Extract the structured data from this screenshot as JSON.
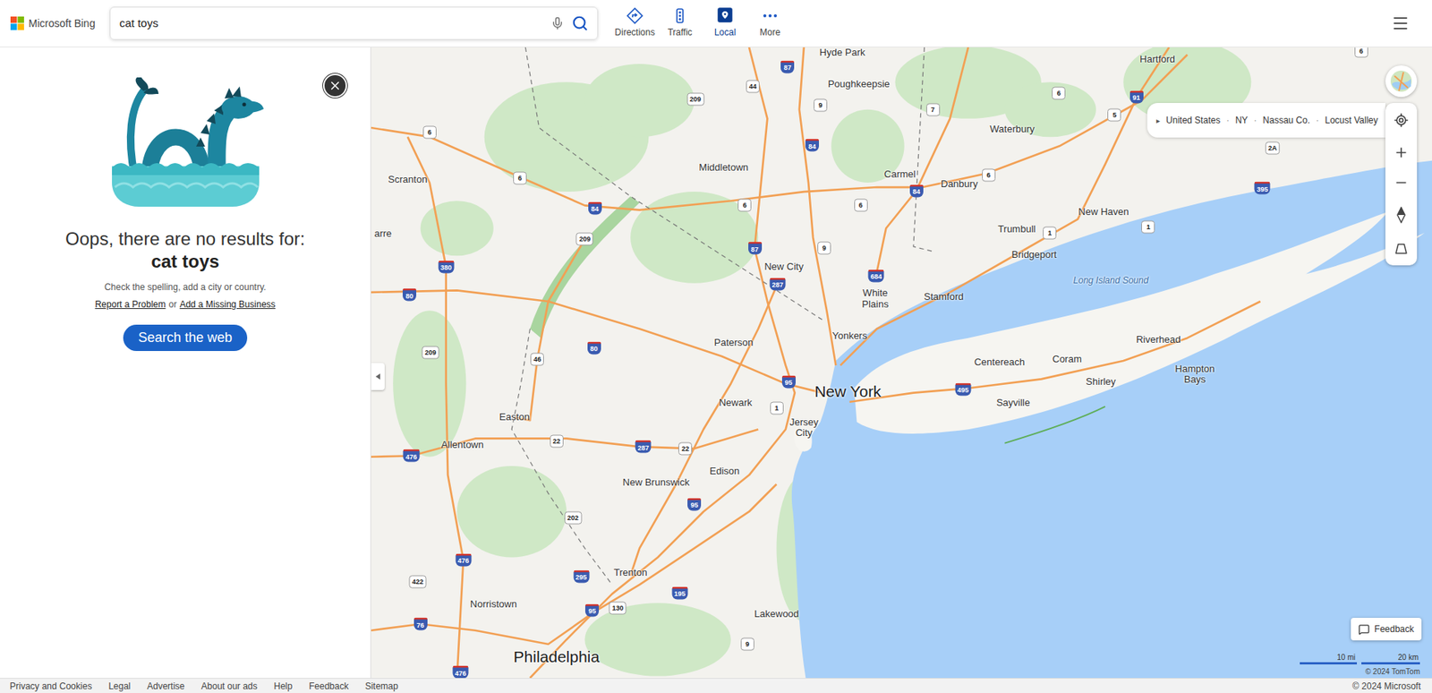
{
  "app": {
    "logo": "Microsoft Bing"
  },
  "search": {
    "value": "cat toys"
  },
  "nav": [
    {
      "label": "Directions",
      "selected": false
    },
    {
      "label": "Traffic",
      "selected": false
    },
    {
      "label": "Local",
      "selected": true
    },
    {
      "label": "More",
      "selected": false
    }
  ],
  "panel": {
    "title": "Oops, there are no results for:",
    "query": "cat toys",
    "hint": "Check the spelling, add a city or country.",
    "links": [
      "Report a Problem",
      "Add a Missing Business"
    ],
    "joiner": "or",
    "button": "Search the web"
  },
  "breadcrumb": {
    "arrow": "▸",
    "separator": "·",
    "items": [
      "United States",
      "NY",
      "Nassau Co.",
      "Locust Valley"
    ]
  },
  "map": {
    "places": [
      {
        "name": "Hyde Park",
        "kind": "city"
      },
      {
        "name": "Poughkeepsie",
        "kind": "city"
      },
      {
        "name": "Hartford",
        "kind": "city"
      },
      {
        "name": "Waterbury",
        "kind": "city"
      },
      {
        "name": "Middletown",
        "kind": "city"
      },
      {
        "name": "Scranton",
        "kind": "city"
      },
      {
        "name": "Carmel",
        "kind": "city"
      },
      {
        "name": "Danbury",
        "kind": "city"
      },
      {
        "name": "New Haven",
        "kind": "city"
      },
      {
        "name": "Trumbull",
        "kind": "city"
      },
      {
        "name": "Bridgeport",
        "kind": "city"
      },
      {
        "name": "New City",
        "kind": "city"
      },
      {
        "name": "Long Island Sound",
        "kind": "water"
      },
      {
        "name": "White Plains",
        "kind": "city"
      },
      {
        "name": "Stamford",
        "kind": "city"
      },
      {
        "name": "Paterson",
        "kind": "city"
      },
      {
        "name": "Yonkers",
        "kind": "city"
      },
      {
        "name": "Riverhead",
        "kind": "city"
      },
      {
        "name": "Centereach",
        "kind": "city"
      },
      {
        "name": "Coram",
        "kind": "city"
      },
      {
        "name": "Hampton Bays",
        "kind": "city"
      },
      {
        "name": "Shirley",
        "kind": "city"
      },
      {
        "name": "New York",
        "kind": "major"
      },
      {
        "name": "Newark",
        "kind": "city"
      },
      {
        "name": "Sayville",
        "kind": "city"
      },
      {
        "name": "Jersey City",
        "kind": "city"
      },
      {
        "name": "Easton",
        "kind": "city"
      },
      {
        "name": "Allentown",
        "kind": "city"
      },
      {
        "name": "Edison",
        "kind": "city"
      },
      {
        "name": "New Brunswick",
        "kind": "city"
      },
      {
        "name": "Trenton",
        "kind": "city"
      },
      {
        "name": "Norristown",
        "kind": "city"
      },
      {
        "name": "Lakewood",
        "kind": "city"
      },
      {
        "name": "Philadelphia",
        "kind": "major"
      },
      {
        "name": "arre",
        "kind": "city"
      }
    ],
    "shields": [
      {
        "number": "87",
        "kind": "interstate"
      },
      {
        "number": "209",
        "kind": "route"
      },
      {
        "number": "44",
        "kind": "route"
      },
      {
        "number": "9",
        "kind": "route"
      },
      {
        "number": "6",
        "kind": "route"
      },
      {
        "number": "7",
        "kind": "route"
      },
      {
        "number": "6",
        "kind": "route"
      },
      {
        "number": "91",
        "kind": "interstate"
      },
      {
        "number": "5",
        "kind": "route"
      },
      {
        "number": "84",
        "kind": "interstate"
      },
      {
        "number": "6",
        "kind": "route"
      },
      {
        "number": "84",
        "kind": "interstate"
      },
      {
        "number": "6",
        "kind": "route"
      },
      {
        "number": "6",
        "kind": "route"
      },
      {
        "number": "84",
        "kind": "interstate"
      },
      {
        "number": "6",
        "kind": "route"
      },
      {
        "number": "2A",
        "kind": "route"
      },
      {
        "number": "395",
        "kind": "interstate"
      },
      {
        "number": "1",
        "kind": "route"
      },
      {
        "number": "1",
        "kind": "route"
      },
      {
        "number": "209",
        "kind": "route"
      },
      {
        "number": "87",
        "kind": "interstate"
      },
      {
        "number": "9",
        "kind": "route"
      },
      {
        "number": "684",
        "kind": "interstate"
      },
      {
        "number": "287",
        "kind": "interstate"
      },
      {
        "number": "380",
        "kind": "interstate"
      },
      {
        "number": "80",
        "kind": "interstate"
      },
      {
        "number": "80",
        "kind": "interstate"
      },
      {
        "number": "46",
        "kind": "route"
      },
      {
        "number": "209",
        "kind": "route"
      },
      {
        "number": "95",
        "kind": "interstate"
      },
      {
        "number": "1",
        "kind": "route"
      },
      {
        "number": "495",
        "kind": "interstate"
      },
      {
        "number": "22",
        "kind": "route"
      },
      {
        "number": "287",
        "kind": "interstate"
      },
      {
        "number": "22",
        "kind": "route"
      },
      {
        "number": "476",
        "kind": "interstate"
      },
      {
        "number": "95",
        "kind": "interstate"
      },
      {
        "number": "202",
        "kind": "route"
      },
      {
        "number": "476",
        "kind": "interstate"
      },
      {
        "number": "295",
        "kind": "interstate"
      },
      {
        "number": "195",
        "kind": "interstate"
      },
      {
        "number": "422",
        "kind": "route"
      },
      {
        "number": "95",
        "kind": "interstate"
      },
      {
        "number": "130",
        "kind": "route"
      },
      {
        "number": "76",
        "kind": "interstate"
      },
      {
        "number": "9",
        "kind": "route"
      },
      {
        "number": "476",
        "kind": "interstate"
      },
      {
        "number": "6",
        "kind": "route"
      }
    ]
  },
  "feedback": "Feedback",
  "scale": [
    "10 mi",
    "20 km"
  ],
  "attribution": "© 2024 TomTom",
  "footer": {
    "links": [
      "Privacy and Cookies",
      "Legal",
      "Advertise",
      "About our ads",
      "Help",
      "Feedback",
      "Sitemap"
    ],
    "copyright": "© 2024 Microsoft"
  }
}
